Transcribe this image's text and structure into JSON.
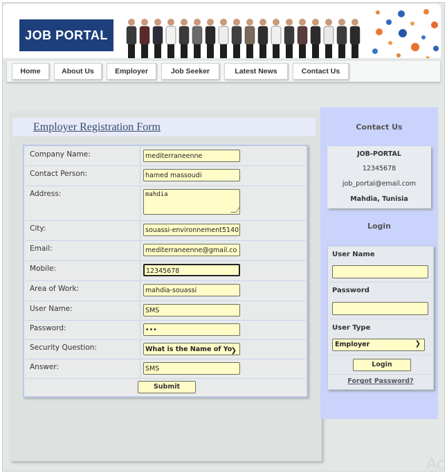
{
  "header": {
    "logo_text": "JOB PORTAL"
  },
  "nav": [
    {
      "label": "Home"
    },
    {
      "label": "About Us"
    },
    {
      "label": "Employer"
    },
    {
      "label": "Job Seeker"
    },
    {
      "label": "Latest News"
    },
    {
      "label": "Contact Us"
    }
  ],
  "form": {
    "title": "Employer Registration Form",
    "fields": [
      {
        "label": "Company Name:",
        "value": "mediterraneenne"
      },
      {
        "label": "Contact Person:",
        "value": "hamed massoudi"
      },
      {
        "label": "Address:",
        "value": "mahdia"
      },
      {
        "label": "City:",
        "value": "souassi-environnement5140"
      },
      {
        "label": "Email:",
        "value": "mediterraneenne@gmail.co"
      },
      {
        "label": "Mobile:",
        "value": "12345678"
      },
      {
        "label": "Area of Work:",
        "value": "mahdia-souassi"
      },
      {
        "label": "User Name:",
        "value": "SMS"
      },
      {
        "label": "Password:",
        "value": "•••"
      },
      {
        "label": "Security Question:",
        "value": "What is the Name of Yo"
      },
      {
        "label": "Answer:",
        "value": "SMS"
      }
    ],
    "submit_label": "Submit"
  },
  "sidebar": {
    "contact_title": "Contact Us",
    "contact": {
      "name": "JOB-PORTAL",
      "phone": "12345678",
      "email": "job_portal@email.com",
      "location": "Mahdia, Tunisia"
    },
    "login_title": "Login",
    "login": {
      "username_label": "User Name",
      "password_label": "Password",
      "usertype_label": "User Type",
      "usertype_value": "Employer",
      "login_button": "Login",
      "forgot_link": "Forgot Password?"
    }
  },
  "watermark": "Ac",
  "colors": {
    "logo_bg": "#1d3f7c",
    "input_bg": "#fffcc7",
    "sidebar_bg": "#c9d3fb",
    "form_title_bg": "#e7eaf9"
  }
}
